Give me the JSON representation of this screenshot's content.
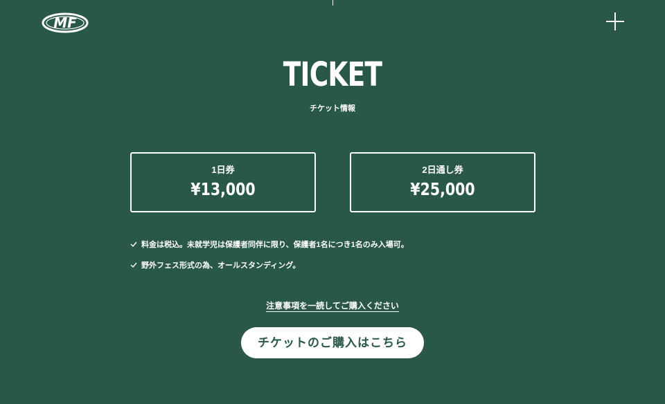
{
  "header": {
    "logo_text": "MF",
    "menu_icon": "plus-icon"
  },
  "section": {
    "title": "TICKET",
    "subtitle": "チケット情報"
  },
  "tickets": [
    {
      "label": "1日券",
      "price": "¥13,000"
    },
    {
      "label": "2日通し券",
      "price": "¥25,000"
    }
  ],
  "notes": [
    "料金は税込。未就学児は保護者同伴に限り、保護者1名につき1名のみ入場可。",
    "野外フェス形式の為、オールスタンディング。"
  ],
  "links": {
    "notice": "注意事項を一読してご購入ください"
  },
  "buttons": {
    "buy": "チケットのご購入はこちら"
  },
  "colors": {
    "background": "#2a5846",
    "foreground": "#ffffff"
  }
}
